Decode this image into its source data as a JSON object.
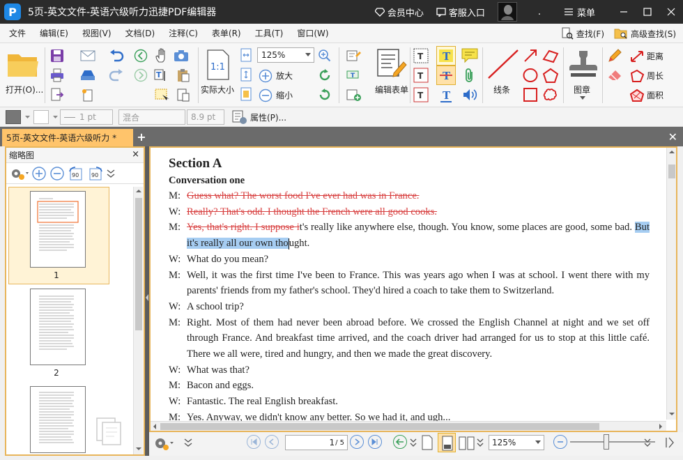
{
  "titlebar": {
    "logo_letter": "P",
    "title": "5页-英文文件-英语六级听力迅捷PDF编辑器",
    "member_center": "会员中心",
    "customer_service": "客服入口",
    "dot": ".",
    "menu": "菜单"
  },
  "menubar": {
    "items": [
      "文件",
      "编辑(E)",
      "视图(V)",
      "文档(D)",
      "注释(C)",
      "表单(R)",
      "工具(T)",
      "窗口(W)"
    ],
    "find": "查找(F)",
    "advanced_find": "高级查找(S)"
  },
  "ribbon": {
    "open": "打开(O)...",
    "actual_size": "实际大小",
    "zoom": "125%",
    "zoom_in": "放大",
    "zoom_out": "缩小",
    "edit_form": "编辑表单",
    "lines": "线条",
    "stamp": "图章",
    "distance": "距离",
    "perimeter": "周长",
    "area": "面积"
  },
  "propbar": {
    "line_width": "1 pt",
    "blend": "混合",
    "font_size": "8.9 pt",
    "properties": "属性(P)..."
  },
  "tab": {
    "title": "5页-英文文件-英语六级听力 *",
    "add": "+",
    "close": "✕"
  },
  "thumbnails": {
    "header": "缩略图",
    "close": "×",
    "pages": [
      "1",
      "2"
    ]
  },
  "document": {
    "section": "Section A",
    "conversation": "Conversation one",
    "lines": [
      {
        "speaker": "M:",
        "segments": [
          {
            "text": "Guess what? The worst food I've ever had was in France.",
            "style": "strike"
          }
        ]
      },
      {
        "speaker": "W:",
        "segments": [
          {
            "text": "Really? That's odd. I thought the French were all good cooks.",
            "style": "strike"
          }
        ]
      },
      {
        "speaker": "M:",
        "segments": [
          {
            "text": "Yes, that's right. I suppose i",
            "style": "strike"
          },
          {
            "text": "t's really like anywhere else, though. You know, some places are good, some bad. ",
            "style": "normal"
          },
          {
            "text": "But it's really all our own tho",
            "style": "highlight"
          },
          {
            "text": "ught.",
            "style": "normal"
          }
        ]
      },
      {
        "speaker": "W:",
        "segments": [
          {
            "text": "What do you mean?",
            "style": "normal"
          }
        ]
      },
      {
        "speaker": "M:",
        "segments": [
          {
            "text": "Well, it was the first time I've been to France. This was years ago when I was at school. I went there with my parents' friends from my father's school. They'd hired a coach to take them to Switzerland.",
            "style": "normal"
          }
        ]
      },
      {
        "speaker": "W:",
        "segments": [
          {
            "text": "A school trip?",
            "style": "normal"
          }
        ]
      },
      {
        "speaker": "M:",
        "segments": [
          {
            "text": "Right. Most of them had never been abroad before. We crossed the English Channel at night and we set off through France. And breakfast time arrived, and the coach driver had arranged for us to stop at this little café. There we all were, tired and hungry, and then we made the great discovery.",
            "style": "normal"
          }
        ]
      },
      {
        "speaker": "W:",
        "segments": [
          {
            "text": "What was that?",
            "style": "normal"
          }
        ]
      },
      {
        "speaker": "M:",
        "segments": [
          {
            "text": "Bacon and eggs.",
            "style": "normal"
          }
        ]
      },
      {
        "speaker": "W:",
        "segments": [
          {
            "text": "Fantastic. The real English breakfast.",
            "style": "normal"
          }
        ]
      },
      {
        "speaker": "M:",
        "segments": [
          {
            "text": "Yes. Anyway, we didn't know any better. So we had it, and ugh...",
            "style": "normal"
          }
        ]
      }
    ]
  },
  "statusbar": {
    "page_current": "1",
    "page_total": "/ 5",
    "zoom": "125%"
  },
  "colors": {
    "accent": "#ffc46b",
    "strike": "#d84040",
    "highlight": "#a6cdf2",
    "link_blue": "#1e88e5"
  }
}
